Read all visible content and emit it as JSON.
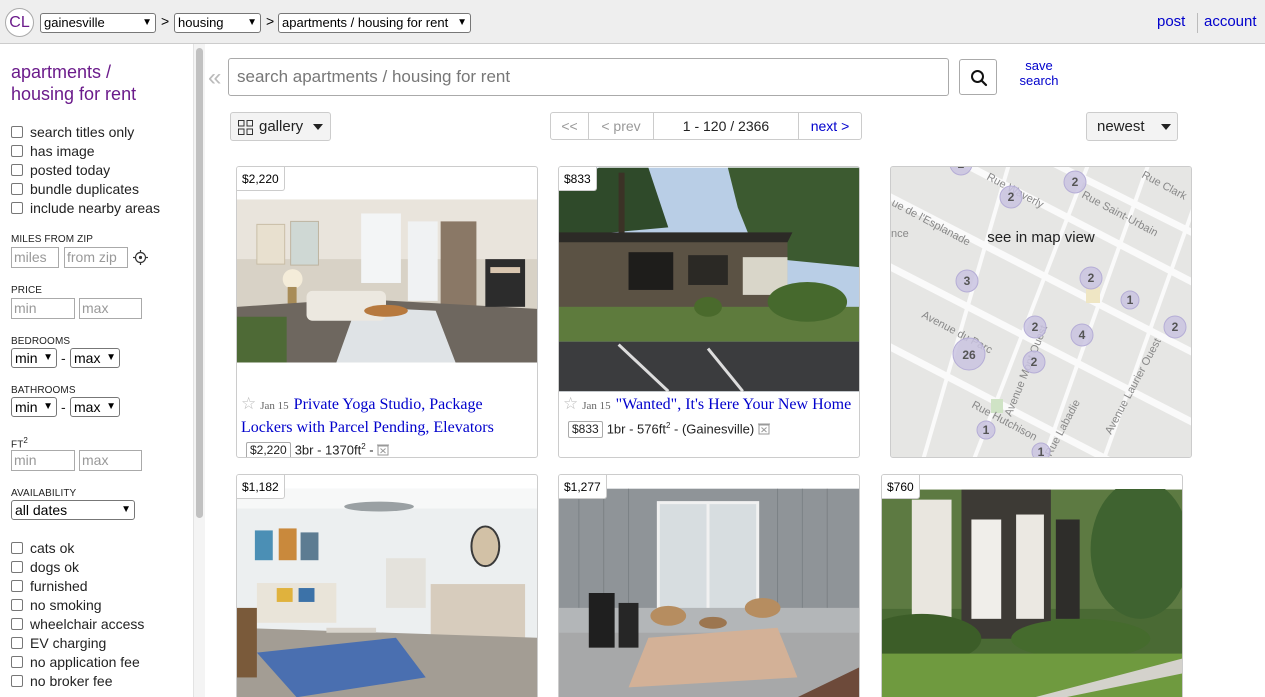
{
  "header": {
    "logo": "CL",
    "location_select": "gainesville",
    "category_select": "housing",
    "subcategory_select": "apartments / housing for rent",
    "separator": ">",
    "post": "post",
    "account": "account"
  },
  "sidebar": {
    "title_line1": "apartments /",
    "title_line2": "housing for rent",
    "filters_top": [
      "search titles only",
      "has image",
      "posted today",
      "bundle duplicates",
      "include nearby areas"
    ],
    "miles_label": "MILES FROM ZIP",
    "miles_placeholder": "miles",
    "zip_placeholder": "from zip",
    "price_label": "PRICE",
    "min_placeholder": "min",
    "max_placeholder": "max",
    "bedrooms_label": "BEDROOMS",
    "bathrooms_label": "BATHROOMS",
    "ft_label": "FT",
    "ft_sup": "2",
    "min_select": "min",
    "max_select": "max",
    "dash": "-",
    "availability_label": "AVAILABILITY",
    "availability_value": "all dates",
    "filters_bottom": [
      "cats ok",
      "dogs ok",
      "furnished",
      "no smoking",
      "wheelchair access",
      "EV charging",
      "no application fee",
      "no broker fee"
    ]
  },
  "search": {
    "placeholder": "search apartments / housing for rent",
    "save_line1": "save",
    "save_line2": "search"
  },
  "toolbar": {
    "view_label": "gallery",
    "first": "<<",
    "prev": "< prev",
    "range": "1 - 120 / 2366",
    "next": "next >",
    "sort": "newest"
  },
  "listings": [
    {
      "price": "$2,220",
      "date": "Jan 15",
      "title_line1": "Private Yoga Studio, Package",
      "title_line2": "Lockers with Parcel Pending, Elevators",
      "meta_price": "$2,220",
      "meta_text": "3br - 1370ft",
      "meta_sup": "2",
      "meta_tail": " -"
    },
    {
      "price": "$833",
      "date": "Jan 15",
      "title_line1": "\"Wanted\", It's Here Your New Home",
      "meta_price": "$833",
      "meta_text": "1br - 576ft",
      "meta_sup": "2",
      "meta_tail": " - (Gainesville)"
    },
    {
      "price": "$1,182"
    },
    {
      "price": "$1,277"
    },
    {
      "price": "$760"
    }
  ],
  "map": {
    "label": "see in map view",
    "streets": [
      "ue de l'Esplanade",
      "Rue Saint-Urbain",
      "Rue Clark",
      "Rue Waverly",
      "Avenue du Parc",
      "Avenue Laurier Ouest",
      "Rue Hutchison",
      "Avenue Laurier Ouest",
      "Rue Labadie",
      "Avenue Mont Ouest",
      "nce"
    ],
    "clusters": [
      "2",
      "2",
      "2",
      "3",
      "2",
      "1",
      "2",
      "4",
      "26",
      "2",
      "2",
      "1",
      "1"
    ]
  },
  "colors": {
    "brand_purple": "#6b1b8b",
    "link_blue": "#0000cc"
  }
}
